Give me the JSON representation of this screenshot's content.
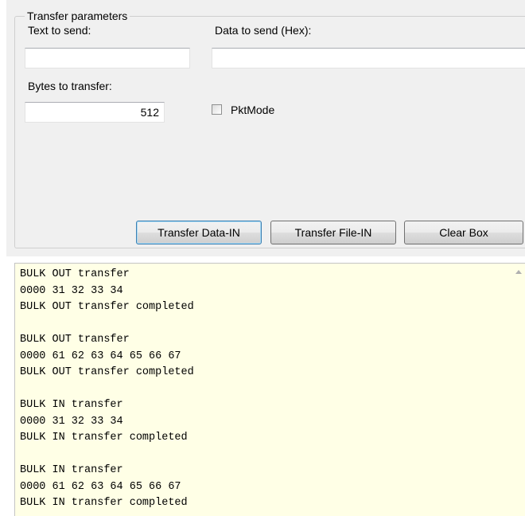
{
  "transfer_params": {
    "group_title": "Transfer parameters",
    "text_to_send": {
      "label": "Text to send:",
      "value": ""
    },
    "data_to_send_hex": {
      "label": "Data to send (Hex):",
      "value": ""
    },
    "bytes_to_transfer": {
      "label": "Bytes to transfer:",
      "value": "512"
    },
    "pktmode": {
      "label": "PktMode",
      "checked": false
    }
  },
  "buttons": {
    "transfer_data_in": "Transfer Data-IN",
    "transfer_file_in": "Transfer File-IN",
    "clear_box": "Clear Box"
  },
  "log": {
    "lines": [
      "BULK OUT transfer",
      "0000 31 32 33 34",
      "BULK OUT transfer completed",
      "",
      "BULK OUT transfer",
      "0000 61 62 63 64 65 66 67",
      "BULK OUT transfer completed",
      "",
      "BULK IN transfer",
      "0000 31 32 33 34",
      "BULK IN transfer completed",
      "",
      "BULK IN transfer",
      "0000 61 62 63 64 65 66 67",
      "BULK IN transfer completed"
    ]
  },
  "colors": {
    "panel_bg": "#f0f0f0",
    "log_bg": "#ffffe6",
    "focus_border": "#3c7fb1"
  }
}
